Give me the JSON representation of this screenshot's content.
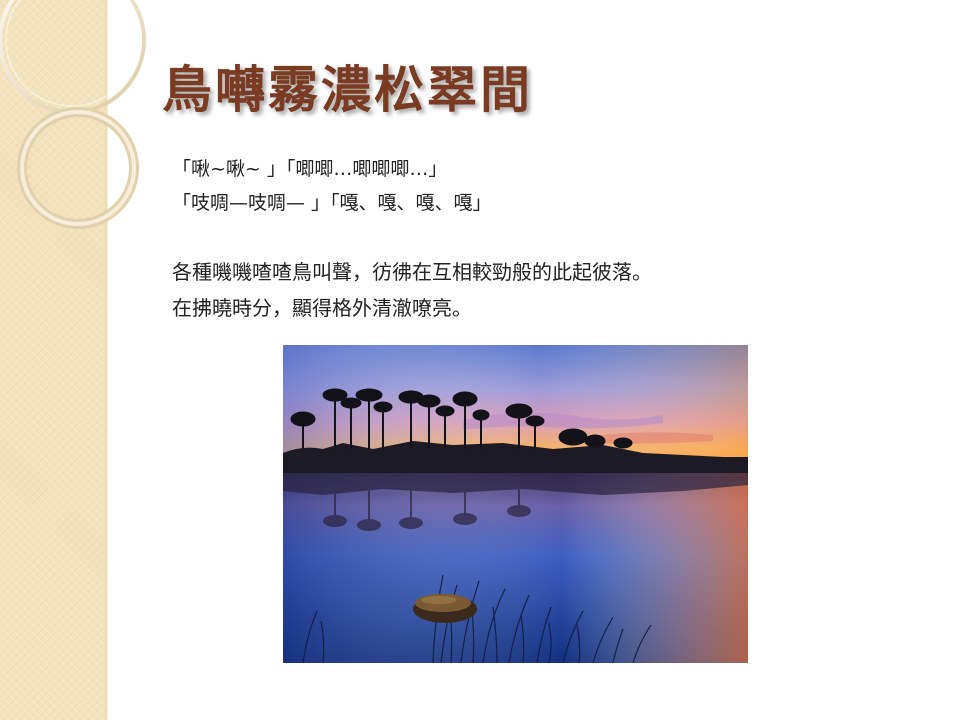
{
  "slide": {
    "title": "鳥囀霧濃松翠間",
    "sound_lines": [
      "「啾~啾~ 」「唧唧…唧唧唧…」",
      "「吱啁—吱啁— 」「嘎、嘎、嘎、嘎」"
    ],
    "description_lines": [
      "各種嘰嘰喳喳鳥叫聲，彷彿在互相較勁般的此起彼落。",
      "在拂曉時分，顯得格外清澈嘹亮。"
    ]
  },
  "colors": {
    "title": "#7b3a22",
    "panel": "#f3e3bd",
    "text": "#222222",
    "sky_top": "#5f7ed0",
    "sky_mid": "#b79bd6",
    "sunset": "#f7a23a",
    "water": "#1e3f9a"
  },
  "icons": {
    "decor": "ring-decoration-icon"
  }
}
